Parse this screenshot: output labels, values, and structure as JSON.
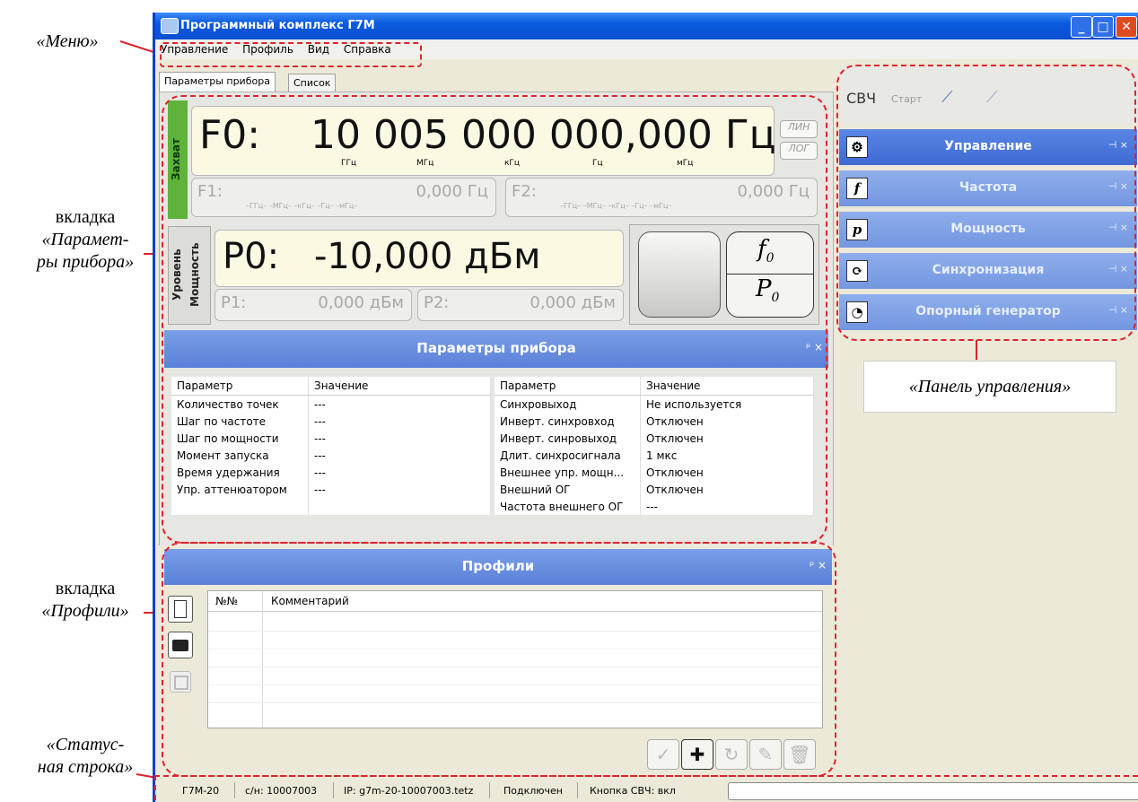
{
  "annotations": {
    "menu": "«Меню»",
    "params_line1": "вкладка",
    "params_line2": "«Парамет-",
    "params_line3": "ры прибора»",
    "profiles_line1": "вкладка",
    "profiles_line2": "«Профили»",
    "status_line1": "«Статус-",
    "status_line2": "ная строка»",
    "control_panel": "«Панель управления»"
  },
  "window": {
    "title": "Программный комплекс Г7М"
  },
  "menu": {
    "items": [
      "Управление",
      "Профиль",
      "Вид",
      "Справка"
    ]
  },
  "tabs": [
    "Параметры прибора",
    "Список"
  ],
  "freq": {
    "capture_label": "Захват",
    "f0_label": "F0:",
    "f0_value": "10 005 000 000,000 Гц",
    "units": [
      "ГГц",
      "МГц",
      "кГц",
      "Гц",
      "мГц"
    ],
    "mode_lin": "ЛИН",
    "mode_log": "ЛОГ",
    "f1_label": "F1:",
    "f1_value": "0,000 Гц",
    "f2_label": "F2:",
    "f2_value": "0,000 Гц",
    "small_units": "–ГГц– –МГц– –кГц– –Гц– –мГц–"
  },
  "power": {
    "level_label": "Уровень",
    "power_label": "Мощность",
    "p0_label": "P0:",
    "p0_value": "-10,000 дБм",
    "p1_label": "P1:",
    "p1_value": "0,000 дБм",
    "p2_label": "P2:",
    "p2_value": "0,000 дБм",
    "f0_sym": "f",
    "f0_sub": "0",
    "p0_sym": "P",
    "p0_sub": "0"
  },
  "params_panel": {
    "title": "Параметры прибора",
    "pin": "ᵖ ×",
    "col_param": "Параметр",
    "col_value": "Значение",
    "left_rows": [
      [
        "Количество точек",
        "---"
      ],
      [
        "Шаг по частоте",
        "---"
      ],
      [
        "Шаг по мощности",
        "---"
      ],
      [
        "Момент запуска",
        "---"
      ],
      [
        "Время удержания",
        "---"
      ],
      [
        "Упр. аттенюатором",
        "---"
      ]
    ],
    "right_rows": [
      [
        "Синхровыход",
        "Не используется"
      ],
      [
        "Инверт. синхровход",
        "Отключен"
      ],
      [
        "Инверт. синровыход",
        "Отключен"
      ],
      [
        "Длит. синхросигнала",
        "1 мкс"
      ],
      [
        "Внешнее упр. мощн...",
        "Отключен"
      ],
      [
        "Внешний ОГ",
        "Отключен"
      ],
      [
        "Частота внешнего ОГ",
        "---"
      ]
    ]
  },
  "profiles_panel": {
    "title": "Профили",
    "pin": "ᵖ ×",
    "col_num": "№№",
    "col_comment": "Комментарий"
  },
  "control_panel": {
    "svch": "СВЧ",
    "start": "Старт",
    "items": [
      {
        "icon": "⚙",
        "label": "Управление"
      },
      {
        "icon": "f",
        "label": "Частота"
      },
      {
        "icon": "p",
        "label": "Мощность"
      },
      {
        "icon": "⟳",
        "label": "Синхронизация"
      },
      {
        "icon": "◔",
        "label": "Опорный генератор"
      }
    ],
    "pin": "⊣ ×"
  },
  "status": {
    "model": "Г7М-20",
    "serial": "с/н: 10007003",
    "ip": "IP: g7m-20-10007003.tetz",
    "conn": "Подключен",
    "svch_button": "Кнопка СВЧ: вкл"
  },
  "colors": {
    "accent": "#5b80d8",
    "dash": "#e0232b",
    "capture": "#5fb33a"
  }
}
